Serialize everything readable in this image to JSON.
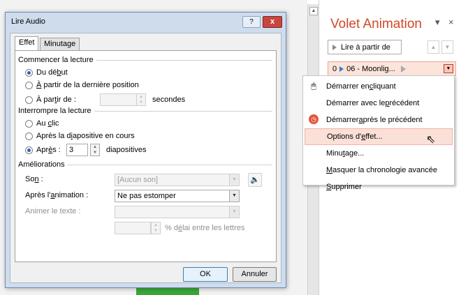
{
  "dialog": {
    "title": "Lire Audio",
    "help_label": "?",
    "close_label": "x",
    "tabs": [
      {
        "label": "Effet"
      },
      {
        "label": "Minutage"
      }
    ],
    "start_group": {
      "title": "Commencer la lecture",
      "opt_beginning": {
        "pre": "Du dé",
        "key": "b",
        "post": "ut"
      },
      "opt_last_pos": {
        "pre": "",
        "key": "À",
        "post": " partir de la dernière position"
      },
      "opt_from": {
        "pre": "À par",
        "key": "t",
        "post": "ir de :"
      },
      "from_value": "",
      "from_unit": "secondes"
    },
    "stop_group": {
      "title": "Interrompre la lecture",
      "opt_click": {
        "pre": "Au ",
        "key": "c",
        "post": "lic"
      },
      "opt_after_slide": {
        "pre": "Après la d",
        "key": "i",
        "post": "apositive en cours"
      },
      "opt_after": {
        "pre": "Apr",
        "key": "è",
        "post": "s :"
      },
      "after_value": "3",
      "after_unit": "diapositives"
    },
    "enhance_group": {
      "title": "Améliorations",
      "sound_label": {
        "pre": "So",
        "key": "n",
        "post": " :"
      },
      "sound_value": "[Aucun son]",
      "after_anim_label": {
        "pre": "Après l'",
        "key": "a",
        "post": "nimation :"
      },
      "after_anim_value": "Ne pas estomper",
      "animate_text_label": "Animer le texte :",
      "animate_text_value": "",
      "delay_value": "",
      "delay_label": {
        "pre": "% d",
        "key": "é",
        "post": "lai entre les lettres"
      }
    },
    "ok_label": "OK",
    "cancel_label": "Annuler"
  },
  "anim_pane": {
    "title": "Volet Animation",
    "dropdown_glyph": "▾",
    "close_glyph": "×",
    "play_label": "Lire à partir de",
    "item_index": "0",
    "item_label": "06 - Moonlig..."
  },
  "context_menu": {
    "items": [
      {
        "pre": "Démarrer en ",
        "key": "c",
        "post": "liquant",
        "icon": "mouse-icon"
      },
      {
        "pre": "Démarrer avec le ",
        "key": "p",
        "post": "récédent",
        "icon": ""
      },
      {
        "pre": "Démarrer ",
        "key": "a",
        "post": "près le précédent",
        "icon": "clock-icon"
      },
      {
        "pre": "Options d'",
        "key": "e",
        "post": "ffet...",
        "icon": ""
      },
      {
        "pre": "Minu",
        "key": "t",
        "post": "age...",
        "icon": ""
      },
      {
        "pre": "",
        "key": "M",
        "post": "asquer la chronologie avancée",
        "icon": ""
      },
      {
        "pre": "",
        "key": "S",
        "post": "upprimer",
        "icon": ""
      }
    ]
  },
  "colors": {
    "accent": "#d24726",
    "highlight": "#fbe0d8",
    "radio_dot": "#2b63b8"
  }
}
